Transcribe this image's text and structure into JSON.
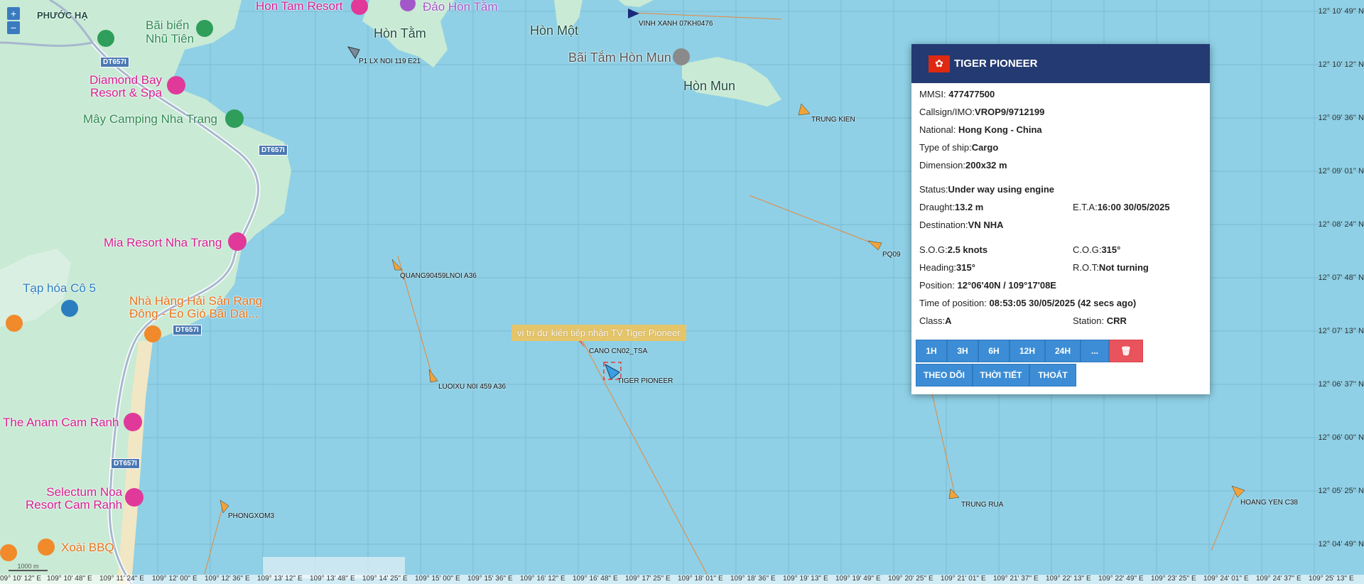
{
  "map": {
    "zoom_in": "+",
    "zoom_out": "−",
    "scale": "1000 m",
    "places": {
      "phuoc_ha": "PHƯỚC HẠ",
      "hon_tam": "Hòn Tằm",
      "hon_mot": "Hòn Một",
      "hon_mun": "Hòn Mun",
      "bai_tam_hon_mun": "Bãi Tắm Hòn Mun",
      "hon_tam_resort": "Hon Tam Resort",
      "dao_hon_tam": "Đảo Hòn Tằm",
      "bai_bien_line1": "Bãi biển",
      "bai_bien_line2": "Nhũ Tiên",
      "diamond_bay_line1": "Diamond Bay",
      "diamond_bay_line2": "Resort & Spa",
      "may_camping": "Mây Camping Nha Trang",
      "mia_resort": "Mia Resort Nha Trang",
      "tap_hoa": "Tạp hóa Cô 5",
      "nha_hang_line1": "Nhà Hàng Hải Sản Rạng",
      "nha_hang_line2": "Đông - Eo Gió Bãi Dài...",
      "anam": "The Anam Cam Ranh",
      "selectum_line1": "Selectum Noa",
      "selectum_line2": "Resort Cam Ranh",
      "xoai_bbq": "Xoài BBQ"
    },
    "roads": [
      "DT657I",
      "DT657I",
      "DT657I",
      "DT657I"
    ],
    "tooltip": "vị trí dự kiến tiếp nhận TV Tiger Pioneer",
    "ships": [
      {
        "label": "VINH XANH 07KH0476"
      },
      {
        "label": "P1 LX NOI 119 E21"
      },
      {
        "label": "TRUNG KIEN"
      },
      {
        "label": "PQ09"
      },
      {
        "label": "QUANG90459LNOI A36"
      },
      {
        "label": "LUOIXU N0I 459 A36"
      },
      {
        "label": "CANO CN02_TSA"
      },
      {
        "label": "TIGER PIONEER"
      },
      {
        "label": "TRUNG RUA"
      },
      {
        "label": "HOANG YEN C38"
      },
      {
        "label": "PHONGXOM3"
      }
    ],
    "lat_labels": [
      "12° 10' 49'' N",
      "12° 10' 12'' N",
      "12° 09' 36'' N",
      "12° 09' 01'' N",
      "12° 08' 24'' N",
      "12° 07' 48'' N",
      "12° 07' 13'' N",
      "12° 06' 37'' N",
      "12° 06' 00'' N",
      "12° 05' 25'' N",
      "12° 04' 49'' N"
    ],
    "lon_labels": [
      "09° 10' 12'' E",
      "109° 10' 48'' E",
      "109° 11' 24'' E",
      "109° 12' 00'' E",
      "109° 12' 36'' E",
      "109° 13' 12'' E",
      "109° 13' 48'' E",
      "109° 14' 25'' E",
      "109° 15' 00'' E",
      "109° 15' 36'' E",
      "109° 16' 12'' E",
      "109° 16' 48'' E",
      "109° 17' 25'' E",
      "109° 18' 01'' E",
      "109° 18' 36'' E",
      "109° 19' 13'' E",
      "109° 19' 49'' E",
      "109° 20' 25'' E",
      "109° 21' 01'' E",
      "109° 21' 37'' E",
      "109° 22' 13'' E",
      "109° 22' 49'' E",
      "109° 23' 25'' E",
      "109° 24' 01'' E",
      "109° 24' 37'' E",
      "109° 25' 13'' E"
    ]
  },
  "popup": {
    "ship_name": "TIGER PIONEER",
    "flag_icon": "hong-kong-flag",
    "mmsi_label": "MMSI:",
    "mmsi": "477477500",
    "callsign_label": "Callsign/IMO:",
    "callsign": "VROP9/9712199",
    "national_label": "National:",
    "national": "Hong Kong - China",
    "type_label": "Type of ship:",
    "type": "Cargo",
    "dimension_label": "Dimension:",
    "dimension": "200x32 m",
    "status_label": "Status:",
    "status": "Under way using engine",
    "draught_label": "Draught:",
    "draught": "13.2 m",
    "eta_label": "E.T.A:",
    "eta": "16:00 30/05/2025",
    "destination_label": "Destination:",
    "destination": "VN NHA",
    "sog_label": "S.O.G:",
    "sog": "2.5 knots",
    "cog_label": "C.O.G:",
    "cog": "315°",
    "heading_label": "Heading:",
    "heading": "315°",
    "rot_label": "R.O.T:",
    "rot": "Not turning",
    "position_label": "Position:",
    "position": "12°06'40N / 109°17'08E",
    "time_label": "Time of position:",
    "time": "08:53:05 30/05/2025 (42 secs ago)",
    "class_label": "Class:",
    "class": "A",
    "station_label": "Station:",
    "station": "CRR",
    "buttons": {
      "h1": "1H",
      "h3": "3H",
      "h6": "6H",
      "h12": "12H",
      "h24": "24H",
      "more": "...",
      "follow": "THEO DÕI",
      "weather": "THỜI TIẾT",
      "exit": "THOÁT"
    }
  },
  "colors": {
    "sea": "#8fd0e6",
    "land": "#c9ead5",
    "popup_header": "#243a72",
    "button": "#3c8dd6",
    "delete": "#e9535c",
    "vessel": "#f1a33a"
  }
}
